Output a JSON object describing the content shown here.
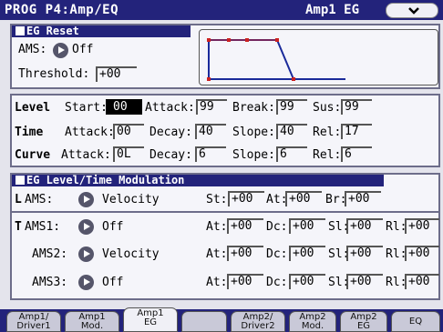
{
  "title": "PROG P4:Amp/EQ",
  "title_right": "Amp1 EG",
  "eg_reset": {
    "header": "EG Reset",
    "ams_label": "AMS:",
    "ams_value": "Off",
    "threshold_label": "Threshold:",
    "threshold_value": "+00"
  },
  "rows": {
    "level": {
      "label": "Level",
      "start_label": "Start:",
      "start": "00",
      "attack_label": "Attack:",
      "attack": "99",
      "break_label": "Break:",
      "break": "99",
      "sus_label": "Sus:",
      "sus": "99"
    },
    "time": {
      "label": "Time",
      "attack_label": "Attack:",
      "attack": "00",
      "decay_label": "Decay:",
      "decay": "40",
      "slope_label": "Slope:",
      "slope": "40",
      "rel_label": "Rel:",
      "rel": "17"
    },
    "curve": {
      "label": "Curve",
      "attack_label": "Attack:",
      "attack": "0L",
      "decay_label": "Decay:",
      "decay": "6",
      "slope_label": "Slope:",
      "slope": "6",
      "rel_label": "Rel:",
      "rel": "6"
    }
  },
  "mod": {
    "header": "EG Level/Time Modulation",
    "lams_prefix": "L",
    "lams_label": "AMS:",
    "lams_value": "Velocity",
    "st_label": "St:",
    "st": "+00",
    "at_label": "At:",
    "at": "+00",
    "br_label": "Br:",
    "br": "+00",
    "tams_prefix": "T",
    "ams1_label": "AMS1:",
    "ams1_value": "Off",
    "ams2_label": "AMS2:",
    "ams2_value": "Velocity",
    "ams3_label": "AMS3:",
    "ams3_value": "Off",
    "t_at_label": "At:",
    "dc_label": "Dc:",
    "sl_label": "Sl:",
    "rl_label": "Rl:",
    "t1": {
      "at": "+00",
      "dc": "+00",
      "sl": "+00",
      "rl": "+00"
    },
    "t2": {
      "at": "+00",
      "dc": "+00",
      "sl": "+00",
      "rl": "+00"
    },
    "t3": {
      "at": "+00",
      "dc": "+00",
      "sl": "+00",
      "rl": "+00"
    }
  },
  "tabs": [
    {
      "line1": "Amp1/",
      "line2": "Driver1"
    },
    {
      "line1": "Amp1",
      "line2": "Mod."
    },
    {
      "line1": "Amp1",
      "line2": "EG"
    },
    {
      "line1": "Amp2/",
      "line2": "Driver2"
    },
    {
      "line1": "Amp2",
      "line2": "Mod."
    },
    {
      "line1": "Amp2",
      "line2": "EG"
    },
    {
      "line1": "EQ",
      "line2": ""
    }
  ],
  "colors": {
    "title_bar": "#23237b",
    "panel_bg": "#f5f5fa",
    "env_red": "#cc2222",
    "env_blue": "#1a2a9a"
  }
}
